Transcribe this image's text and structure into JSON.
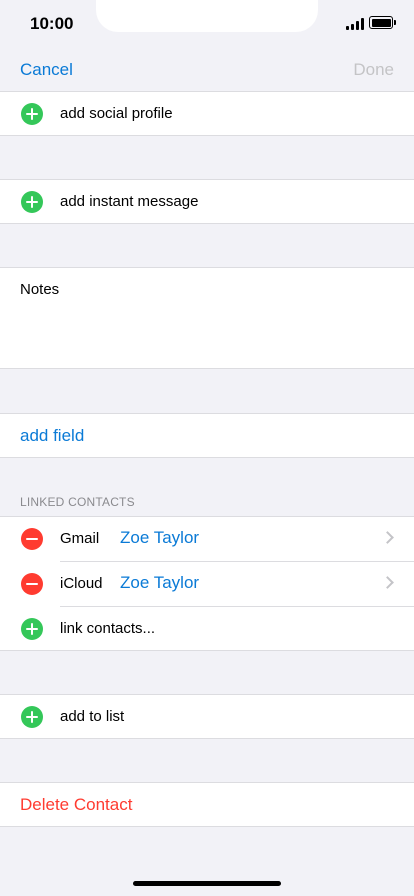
{
  "status_bar": {
    "time": "10:00"
  },
  "nav": {
    "cancel_label": "Cancel",
    "done_label": "Done"
  },
  "rows": {
    "add_social_profile": "add social profile",
    "add_instant_message": "add instant message",
    "notes_label": "Notes",
    "add_field": "add field",
    "link_contacts": "link contacts...",
    "add_to_list": "add to list",
    "delete_contact": "Delete Contact"
  },
  "linked_contacts": {
    "header": "LINKED CONTACTS",
    "items": [
      {
        "service": "Gmail",
        "name": "Zoe Taylor"
      },
      {
        "service": "iCloud",
        "name": "Zoe Taylor"
      }
    ]
  },
  "colors": {
    "accent": "#0a7ad6",
    "add_green": "#34c759",
    "remove_red": "#ff3b30",
    "disabled": "#c4c4c6",
    "background": "#f2f2f7"
  },
  "icons": {
    "add": "plus-circle-icon",
    "remove": "minus-circle-icon",
    "disclosure": "chevron-right-icon"
  }
}
